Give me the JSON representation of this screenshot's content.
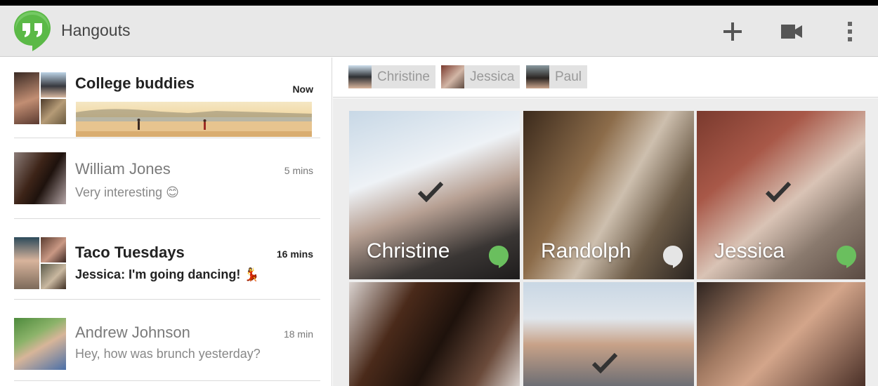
{
  "app": {
    "title": "Hangouts"
  },
  "colors": {
    "brand_green": "#59b946",
    "appbar_bg": "#e8e8e8",
    "online_green": "#6abf5e",
    "away_gray": "#e5e5e5"
  },
  "toolbar": {
    "add_icon": "plus-icon",
    "video_icon": "video-camera-icon",
    "menu_icon": "overflow-menu-icon"
  },
  "conversations": [
    {
      "name": "College buddies",
      "time": "Now",
      "message": "",
      "unread": true
    },
    {
      "name": "William Jones",
      "time": "5 mins",
      "message": "Very interesting 😊",
      "unread": false
    },
    {
      "name": "Taco Tuesdays",
      "time": "16 mins",
      "message": "Jessica: I'm going dancing! 💃",
      "unread": true
    },
    {
      "name": "Andrew Johnson",
      "time": "18 min",
      "message": "Hey, how was brunch yesterday?",
      "unread": false
    }
  ],
  "participants": [
    {
      "name": "Christine"
    },
    {
      "name": "Jessica"
    },
    {
      "name": "Paul"
    }
  ],
  "tiles": [
    {
      "name": "Christine",
      "selected": true,
      "status": "online"
    },
    {
      "name": "Randolph",
      "selected": false,
      "status": "away"
    },
    {
      "name": "Jessica",
      "selected": true,
      "status": "online"
    },
    {
      "name": "",
      "selected": false,
      "status": ""
    },
    {
      "name": "",
      "selected": true,
      "status": ""
    },
    {
      "name": "",
      "selected": false,
      "status": ""
    }
  ]
}
